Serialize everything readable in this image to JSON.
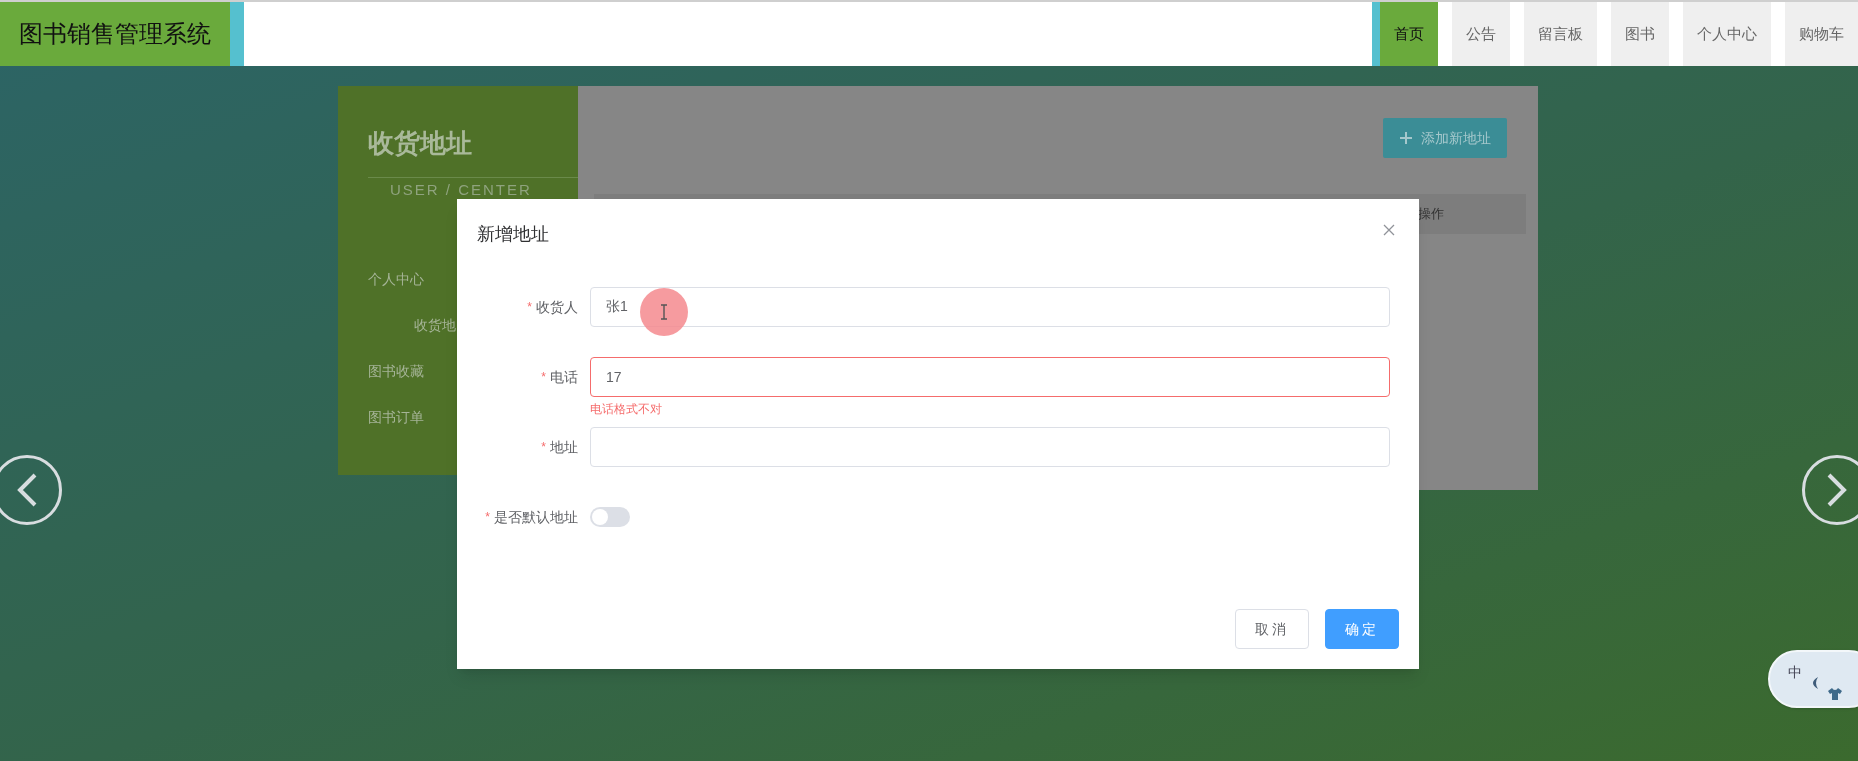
{
  "header": {
    "title": "图书销售管理系统",
    "nav": [
      {
        "label": "首页",
        "selected": true
      },
      {
        "label": "公告",
        "selected": false
      },
      {
        "label": "留言板",
        "selected": false
      },
      {
        "label": "图书",
        "selected": false
      },
      {
        "label": "个人中心",
        "selected": false
      },
      {
        "label": "购物车",
        "selected": false
      }
    ]
  },
  "sidebar": {
    "title": "收货地址",
    "subtitle": "USER / CENTER",
    "items": [
      {
        "label": "个人中心",
        "children": [
          {
            "label": "收货地"
          }
        ]
      },
      {
        "label": "图书收藏"
      },
      {
        "label": "图书订单"
      }
    ]
  },
  "content": {
    "add_button": "添加新地址",
    "table_header": "操作"
  },
  "dialog": {
    "title": "新增地址",
    "fields": [
      {
        "kind": "input",
        "required_mark": "*",
        "label": "收货人",
        "value": "张1"
      },
      {
        "kind": "input",
        "required_mark": "*",
        "label": "电话",
        "value": "17",
        "error": "电话格式不对"
      },
      {
        "kind": "input",
        "required_mark": "*",
        "label": "地址"
      },
      {
        "kind": "switch",
        "required_mark": "*",
        "label": "是否默认地址",
        "on": false
      }
    ],
    "buttons": [
      {
        "label": "取消",
        "kind": "default"
      },
      {
        "label": "确定",
        "kind": "primary"
      }
    ]
  },
  "ime": {
    "label": "中"
  }
}
